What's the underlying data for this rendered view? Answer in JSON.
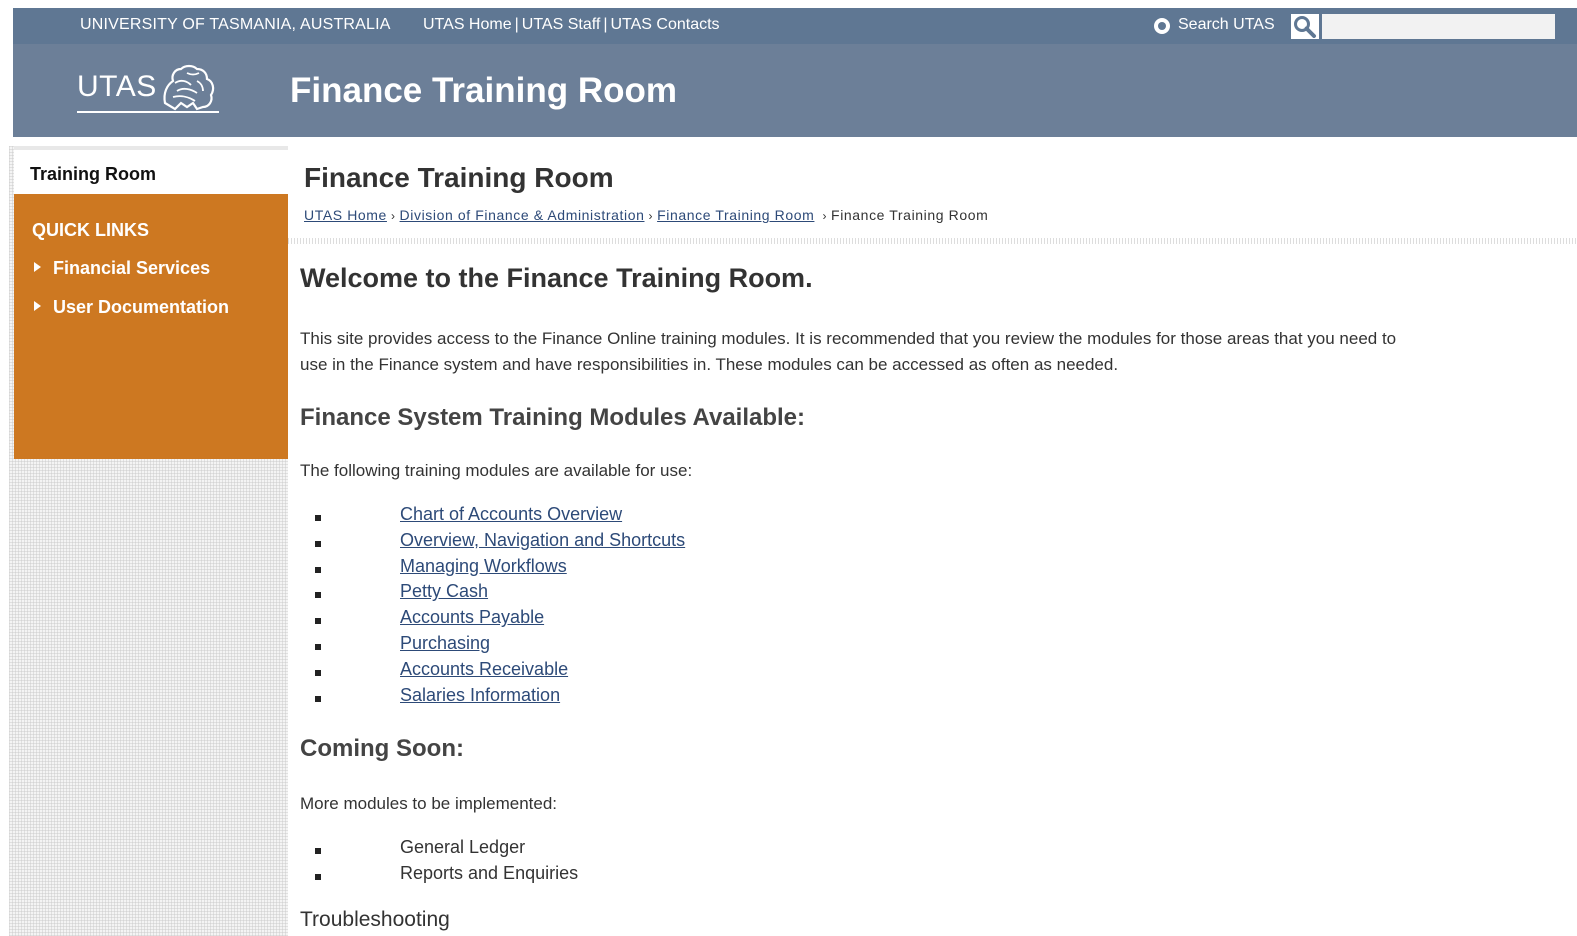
{
  "colors": {
    "utility_bar": "#5f7793",
    "banner": "#6c7f98",
    "quick_links_bg": "#cd7821",
    "link": "#2d4a78"
  },
  "utility": {
    "university": "UNIVERSITY OF TASMANIA, AUSTRALIA",
    "links": [
      "UTAS Home",
      "UTAS Staff",
      "UTAS Contacts"
    ],
    "search_label": "Search UTAS",
    "search_placeholder": "",
    "search_icon": "magnifier-icon"
  },
  "banner": {
    "logo_text": "UTAS",
    "logo_icon": "lion-crest-icon",
    "title": "Finance Training Room"
  },
  "sidebar": {
    "section_title": "Training Room",
    "quick_links_title": "QUICK LINKS",
    "quick_links": [
      "Financial Services",
      "User Documentation"
    ]
  },
  "main": {
    "page_title": "Finance Training Room",
    "breadcrumb": {
      "links": [
        "UTAS Home",
        "Division of Finance & Administration",
        "Finance Training Room"
      ],
      "current": "Finance Training Room"
    },
    "welcome_heading": "Welcome to the Finance Training Room.",
    "intro_line1": "This site provides access to the Finance Online training modules.  It is recommended that you review the modules for those areas that you need to",
    "intro_line2": "use in the Finance system and have responsibilities in.  These modules can be accessed as often as needed.",
    "modules_heading": "Finance System Training Modules Available:",
    "modules_intro": "The following training modules are available for use:",
    "modules": [
      "Chart of Accounts Overview",
      "Overview, Navigation and Shortcuts",
      "Managing Workflows",
      "Petty Cash",
      "Accounts Payable",
      "Purchasing",
      "Accounts Receivable",
      "Salaries Information"
    ],
    "coming_soon_heading": "Coming Soon:",
    "coming_soon_intro": "More modules to be implemented:",
    "coming_soon": [
      "General Ledger",
      "Reports and Enquiries"
    ],
    "troubleshooting": "Troubleshooting"
  }
}
